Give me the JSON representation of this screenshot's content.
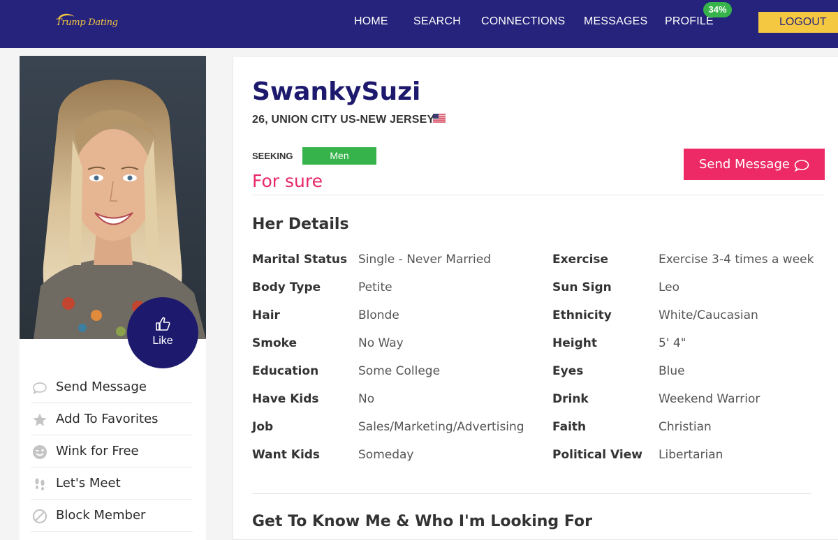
{
  "brand": {
    "logo_text": "Trump Dating"
  },
  "nav": {
    "items": [
      {
        "label": "HOME"
      },
      {
        "label": "SEARCH"
      },
      {
        "label": "CONNECTIONS"
      },
      {
        "label": "MESSAGES"
      },
      {
        "label": "PROFILE"
      }
    ],
    "profile_completion": "34%",
    "logout_label": "LOGOUT"
  },
  "sidebar": {
    "like_label": "Like",
    "actions": [
      {
        "label": "Send Message",
        "icon": "speech-bubble-icon"
      },
      {
        "label": "Add To Favorites",
        "icon": "star-icon"
      },
      {
        "label": "Wink for Free",
        "icon": "wink-face-icon"
      },
      {
        "label": "Let's Meet",
        "icon": "footprints-icon"
      },
      {
        "label": "Block Member",
        "icon": "block-icon"
      }
    ]
  },
  "profile": {
    "username": "SwankySuzi",
    "location": "26, UNION CITY US-NEW JERSEY",
    "seeking_label": "SEEKING",
    "seeking_value": "Men",
    "tagline": "For sure",
    "send_message_label": "Send Message"
  },
  "details": {
    "title": "Her Details",
    "left": [
      {
        "label": "Marital Status",
        "value": "Single - Never Married"
      },
      {
        "label": "Body Type",
        "value": "Petite"
      },
      {
        "label": "Hair",
        "value": "Blonde"
      },
      {
        "label": "Smoke",
        "value": "No Way"
      },
      {
        "label": "Education",
        "value": "Some College"
      },
      {
        "label": "Have Kids",
        "value": "No"
      },
      {
        "label": "Job",
        "value": "Sales/Marketing/Advertising"
      },
      {
        "label": "Want Kids",
        "value": "Someday"
      }
    ],
    "right": [
      {
        "label": "Exercise",
        "value": "Exercise 3-4 times a week"
      },
      {
        "label": "Sun Sign",
        "value": "Leo"
      },
      {
        "label": "Ethnicity",
        "value": "White/Caucasian"
      },
      {
        "label": "Height",
        "value": "5' 4\""
      },
      {
        "label": "Eyes",
        "value": "Blue"
      },
      {
        "label": "Drink",
        "value": "Weekend Warrior"
      },
      {
        "label": "Faith",
        "value": "Christian"
      },
      {
        "label": "Political View",
        "value": "Libertarian"
      }
    ]
  },
  "about": {
    "title": "Get To Know Me & Who I'm Looking For"
  },
  "colors": {
    "nav_bg": "#25237b",
    "accent_gold": "#f5c842",
    "accent_pink": "#ee2a66",
    "accent_green": "#36b34a",
    "username": "#1d1a6e"
  }
}
